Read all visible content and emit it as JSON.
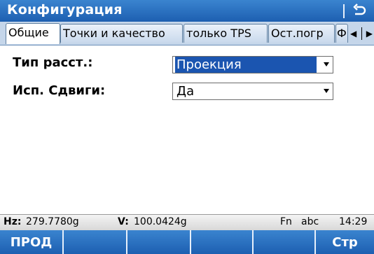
{
  "title": "Конфигурация",
  "icons": {
    "back": "back-return-icon",
    "scroll_left": "scroll-left-icon",
    "scroll_right": "scroll-right-icon"
  },
  "tabs": [
    "Общие",
    "Точки и качество",
    "только TPS",
    "Ост.погр",
    "Ф"
  ],
  "active_tab": "Общие",
  "fields": [
    {
      "label": "Тип расст.:",
      "value": "Проекция"
    },
    {
      "label": "Исп. Сдвиги:",
      "value": "Да"
    }
  ],
  "status": {
    "hz_label": "Hz:",
    "hz_value": "279.7780g",
    "v_label": "V:",
    "v_value": "100.0424g",
    "fn": "Fn",
    "input_mode": "abc",
    "time": "14:29"
  },
  "softkeys": [
    "ПРОД",
    "",
    "",
    "",
    "",
    "Стр"
  ],
  "colors": {
    "accent": "#1d5fb1",
    "tab_bg": "#c5d6ea",
    "selection": "#1b55b0"
  }
}
